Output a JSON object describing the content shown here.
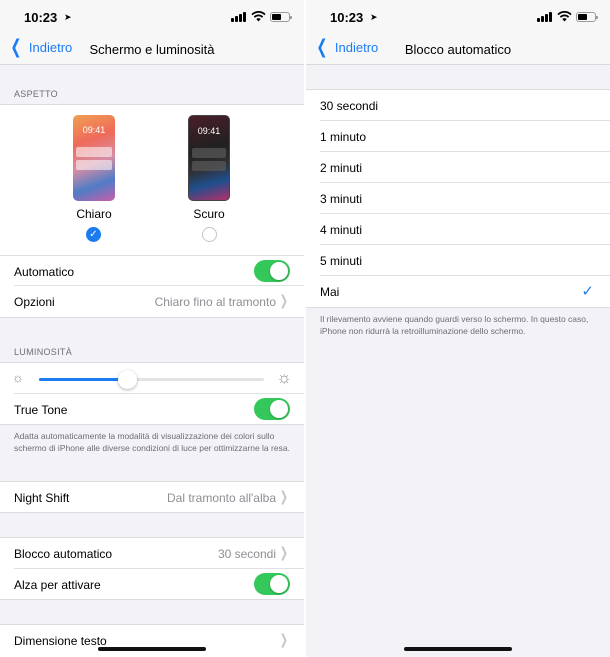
{
  "left": {
    "status": {
      "time": "10:23"
    },
    "nav": {
      "back": "Indietro",
      "title": "Schermo e luminosità"
    },
    "aspetto": {
      "header": "ASPETTO",
      "light": {
        "time": "09:41",
        "label": "Chiaro",
        "selected": true
      },
      "dark": {
        "time": "09:41",
        "label": "Scuro",
        "selected": false
      },
      "automatico": {
        "label": "Automatico",
        "on": true
      },
      "opzioni": {
        "label": "Opzioni",
        "value": "Chiaro fino al tramonto"
      }
    },
    "luminosita": {
      "header": "LUMINOSITÀ",
      "brightness_fraction": 0.39,
      "true_tone": {
        "label": "True Tone",
        "on": true
      },
      "footnote": "Adatta automaticamente la modalità di visualizzazione dei colori sullo schermo di iPhone alle diverse condizioni di luce per ottimizzarne la resa."
    },
    "night_shift": {
      "label": "Night Shift",
      "value": "Dal tramonto all'alba"
    },
    "blocco": {
      "label": "Blocco automatico",
      "value": "30 secondi"
    },
    "alza": {
      "label": "Alza per attivare",
      "on": true
    },
    "dimensione": {
      "label": "Dimensione testo"
    }
  },
  "right": {
    "status": {
      "time": "10:23"
    },
    "nav": {
      "back": "Indietro",
      "title": "Blocco automatico"
    },
    "options": [
      {
        "label": "30 secondi",
        "selected": false
      },
      {
        "label": "1 minuto",
        "selected": false
      },
      {
        "label": "2 minuti",
        "selected": false
      },
      {
        "label": "3 minuti",
        "selected": false
      },
      {
        "label": "4 minuti",
        "selected": false
      },
      {
        "label": "5 minuti",
        "selected": false
      },
      {
        "label": "Mai",
        "selected": true
      }
    ],
    "footnote": "Il rilevamento avviene quando guardi verso lo schermo. In questo caso, iPhone non ridurrà la retroilluminazione dello schermo."
  },
  "colors": {
    "accent": "#1b7cf2",
    "toggle_on": "#34c759",
    "background": "#f2f2f7"
  },
  "icons": [
    "location-arrow-icon",
    "signal-icon",
    "wifi-icon",
    "battery-icon",
    "chevron-left-icon",
    "chevron-right-icon",
    "checkmark-icon",
    "sun-small-icon",
    "sun-large-icon"
  ]
}
